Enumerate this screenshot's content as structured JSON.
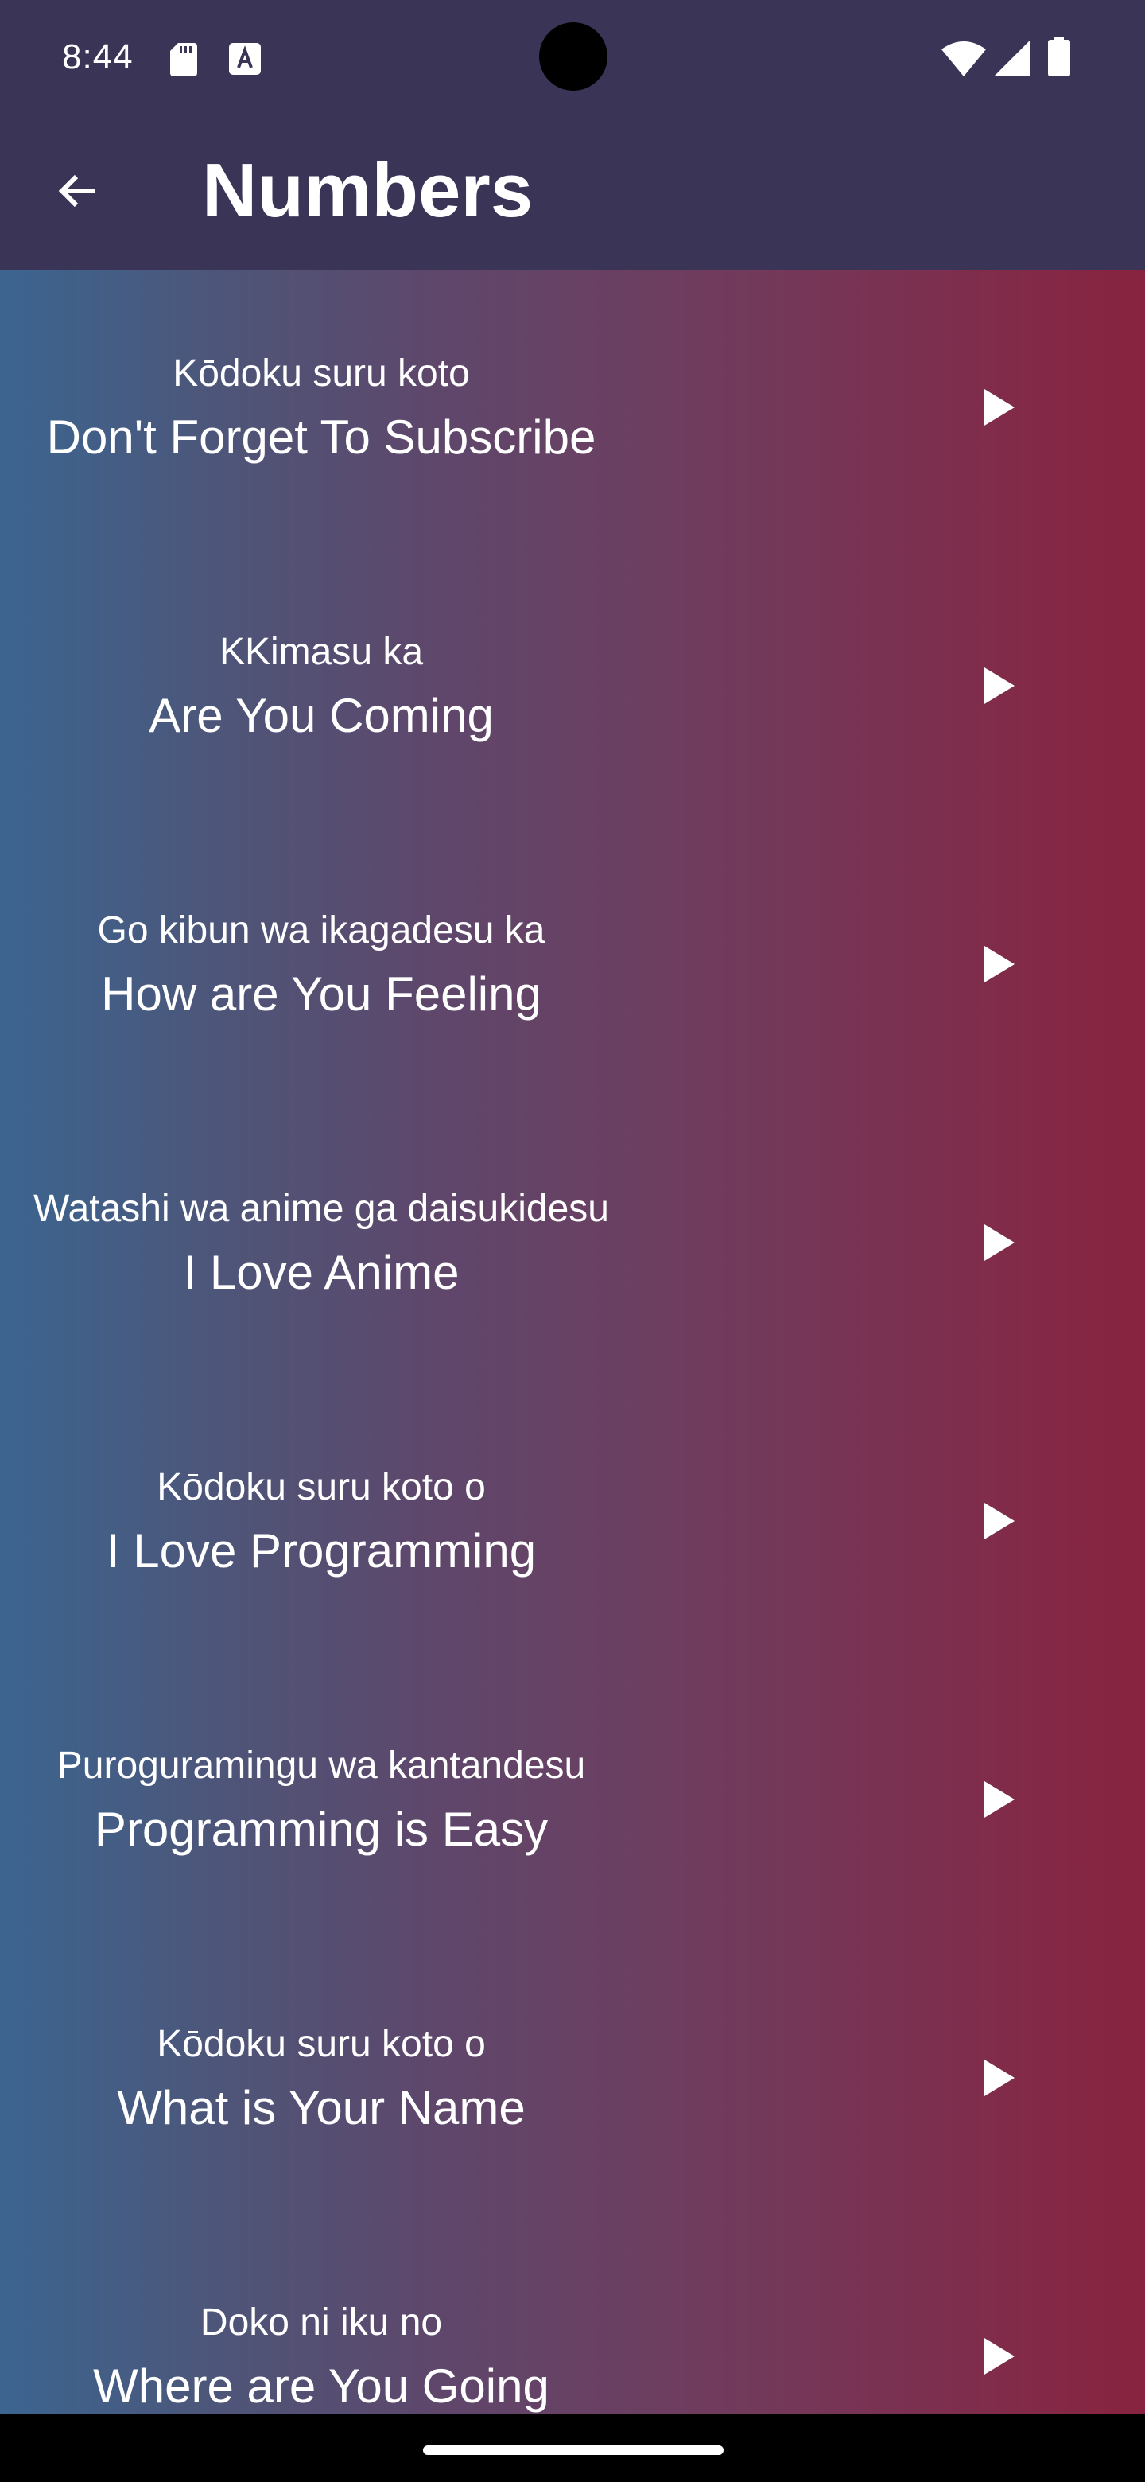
{
  "status_bar": {
    "time": "8:44",
    "icons": [
      "sd-card-icon",
      "keyboard-a-icon",
      "wifi-icon",
      "cell-signal-icon",
      "battery-icon"
    ]
  },
  "app_bar": {
    "back_icon": "arrow-back-icon",
    "title": "Numbers"
  },
  "colors": {
    "app_bar": "#3a3456",
    "gradient_start": "#3b6590",
    "gradient_end": "#88233f",
    "text": "#ffffff"
  },
  "phrases": [
    {
      "romaji": "Kōdoku suru koto",
      "english": "Don't Forget To Subscribe"
    },
    {
      "romaji": "KKimasu ka",
      "english": "Are You Coming"
    },
    {
      "romaji": "Go kibun wa ikagadesu ka",
      "english": "How are You Feeling"
    },
    {
      "romaji": "Watashi wa anime ga daisukidesu",
      "english": "I Love Anime"
    },
    {
      "romaji": "Kōdoku suru koto o",
      "english": "I Love Programming"
    },
    {
      "romaji": "Puroguramingu wa kantandesu",
      "english": "Programming is Easy"
    },
    {
      "romaji": "Kōdoku suru koto o",
      "english": "What is Your Name"
    },
    {
      "romaji": "Doko ni iku no",
      "english": "Where are You Going"
    }
  ],
  "play_icon": "play-icon"
}
